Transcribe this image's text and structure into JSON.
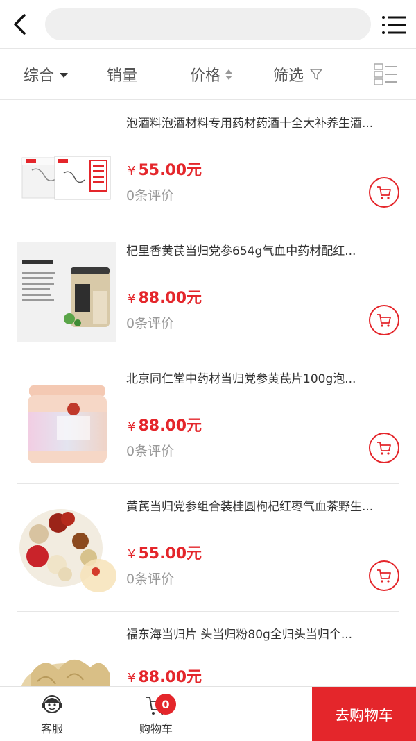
{
  "header": {
    "back_icon": "chevron-left-icon",
    "search_placeholder": "",
    "menu_icon": "list-menu-icon"
  },
  "sort": {
    "items": [
      {
        "label": "综合",
        "indicator": "caret-down"
      },
      {
        "label": "销量",
        "indicator": "none"
      },
      {
        "label": "价格",
        "indicator": "sort-updown"
      },
      {
        "label": "筛选",
        "indicator": "filter-funnel"
      }
    ],
    "view_toggle_icon": "grid-list-toggle-icon"
  },
  "products": [
    {
      "name": "泡酒料泡酒材料专用药材药酒十全大补养生酒...",
      "currency": "¥",
      "price": "55.00元",
      "reviews": "0条评价",
      "image": "product-box-image"
    },
    {
      "name": "杞里香黄芪当归党参654g气血中药材配红...",
      "currency": "¥",
      "price": "88.00元",
      "reviews": "0条评价",
      "image": "product-jars-image"
    },
    {
      "name": "北京同仁堂中药材当归党参黄芪片100g泡...",
      "currency": "¥",
      "price": "88.00元",
      "reviews": "0条评价",
      "image": "product-canister-image"
    },
    {
      "name": "黄芪当归党参组合装桂圆枸杞红枣气血茶野生...",
      "currency": "¥",
      "price": "55.00元",
      "reviews": "0条评价",
      "image": "product-herb-platter-image"
    },
    {
      "name": "福东海当归片 头当归粉80g全归头当归个...",
      "currency": "¥",
      "price": "88.00元",
      "reviews": "",
      "image": "product-slices-image"
    }
  ],
  "bottom": {
    "service_label": "客服",
    "cart_label": "购物车",
    "cart_count": "0",
    "go_cart_label": "去购物车"
  },
  "colors": {
    "accent": "#e4262b",
    "muted_text": "#999999",
    "divider": "#e6e6e6",
    "search_bg": "#efefef"
  }
}
